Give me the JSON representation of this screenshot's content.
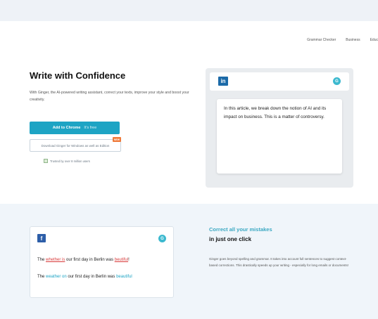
{
  "nav": {
    "items": [
      "Grammar Checker",
      "Business",
      "Educ"
    ]
  },
  "hero": {
    "title": "Write with Confidence",
    "description": "With Ginger, the AI-powered writing assistant, correct your texts, improve your style and boost your creativity.",
    "primary_button": {
      "label": "Add to Chrome",
      "sub_label": "It's free"
    },
    "secondary_button": {
      "label": "Download Ginger for Windows as well as Edition"
    },
    "new_badge": "NEW",
    "trust_text": "Trusted by over 8 million users"
  },
  "linkedin_card": {
    "logo": "in",
    "ginger_logo": "G",
    "text": "In this article, we break down the notion of AI and its impact on business. This is a matter of controversy."
  },
  "facebook_card": {
    "logo": "f",
    "ginger_logo": "G",
    "sentence_wrong": {
      "a": "The ",
      "err1": "whether is",
      "b": " our first day in Berlin was ",
      "err2": "beutiful",
      "c": "!"
    },
    "sentence_fixed": {
      "a": "The ",
      "fix1": "weather on",
      "b": " our first day in Berlin was ",
      "fix2": "beautiful"
    }
  },
  "feature": {
    "title": "Correct all your mistakes",
    "subtitle": "in just one click",
    "description": "Ginger goes beyond spelling and grammar. It takes into account full sentences to suggest context-based corrections. This drastically speeds up your writing - especially for long emails or documents!"
  },
  "colors": {
    "accent": "#1da4c4",
    "linkedin": "#1c6aa8",
    "facebook": "#2d5ea8",
    "badge": "#ef7a3a",
    "error": "#d93b3b"
  },
  "icons": {
    "linkedin": "linkedin-icon",
    "facebook": "facebook-icon",
    "ginger": "ginger-logo-icon",
    "check": "checkbox-icon"
  }
}
